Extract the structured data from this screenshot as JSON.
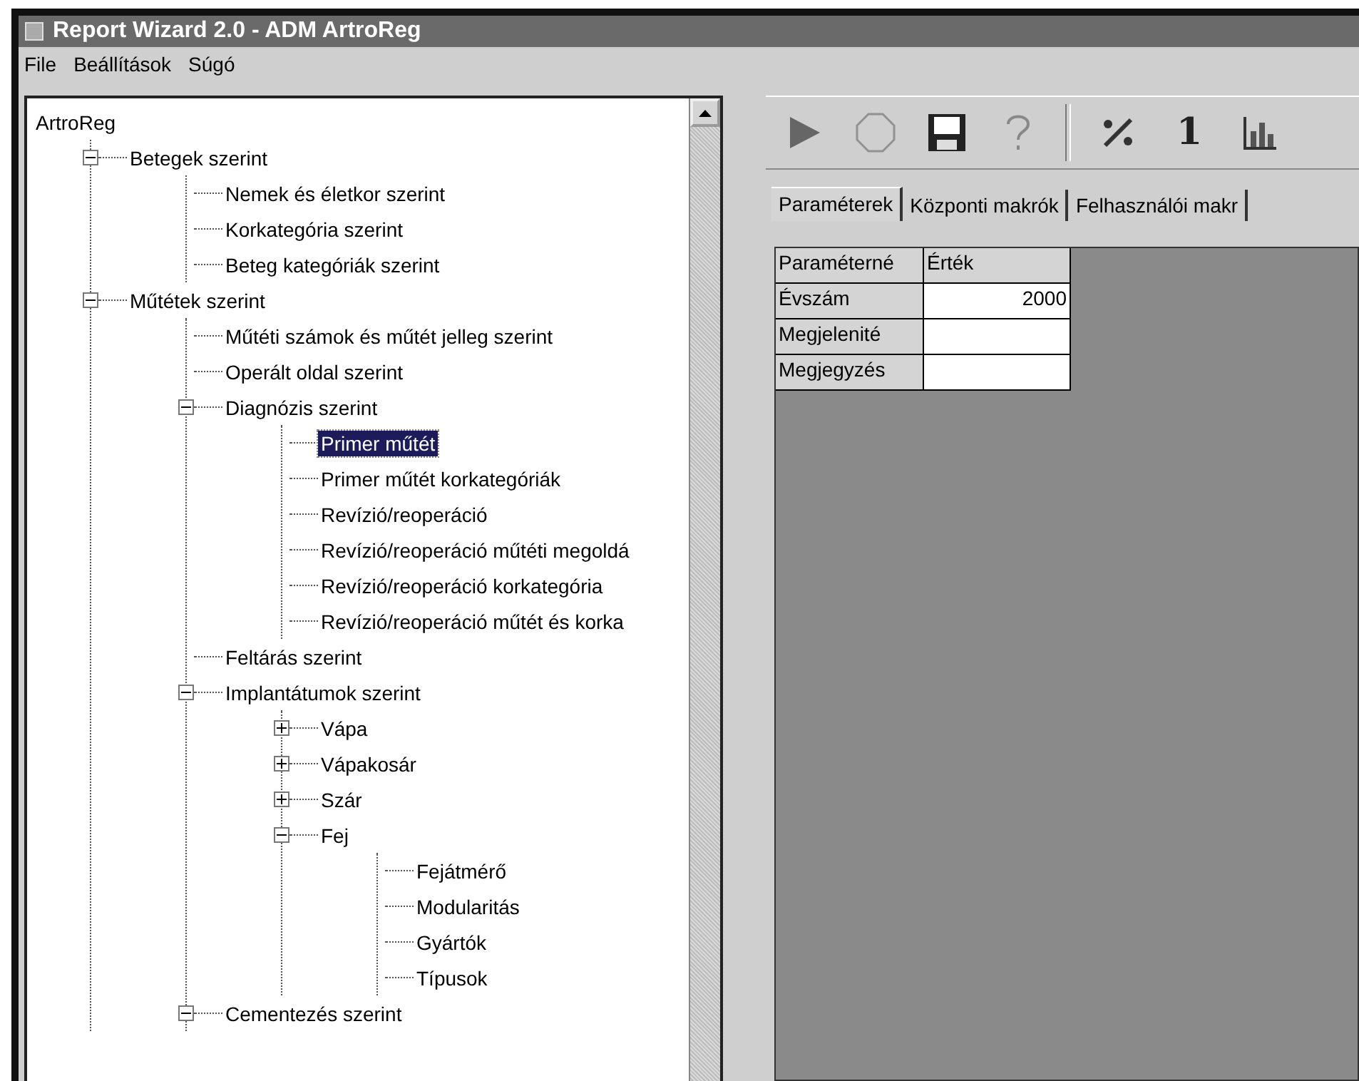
{
  "window": {
    "title": "Report Wizard 2.0 - ADM ArtroReg"
  },
  "menu": [
    "File",
    "Beállítások",
    "Súgó"
  ],
  "tree": {
    "label": "ArtroReg",
    "selected": false,
    "children": [
      {
        "label": "Betegek szerint",
        "expanded": true,
        "selected": false,
        "children": [
          {
            "label": "Nemek és életkor szerint",
            "selected": false
          },
          {
            "label": "Korkategória szerint",
            "selected": false
          },
          {
            "label": "Beteg kategóriák szerint",
            "selected": false
          }
        ]
      },
      {
        "label": "Műtétek szerint",
        "expanded": true,
        "selected": false,
        "children": [
          {
            "label": "Műtéti számok és műtét jelleg szerint",
            "selected": false
          },
          {
            "label": "Operált oldal szerint",
            "selected": false
          },
          {
            "label": "Diagnózis szerint",
            "expanded": true,
            "selected": false,
            "children": [
              {
                "label": "Primer műtét",
                "selected": true
              },
              {
                "label": "Primer műtét korkategóriák",
                "selected": false
              },
              {
                "label": "Revízió/reoperáció",
                "selected": false
              },
              {
                "label": "Revízió/reoperáció műtéti megoldá",
                "selected": false
              },
              {
                "label": "Revízió/reoperáció korkategória",
                "selected": false
              },
              {
                "label": "Revízió/reoperáció műtét és korka",
                "selected": false
              }
            ]
          },
          {
            "label": "Feltárás szerint",
            "selected": false
          },
          {
            "label": "Implantátumok szerint",
            "expanded": true,
            "selected": false,
            "children": [
              {
                "label": "Vápa",
                "expanded": false,
                "selected": false
              },
              {
                "label": "Vápakosár",
                "expanded": false,
                "selected": false
              },
              {
                "label": "Szár",
                "expanded": false,
                "selected": false
              },
              {
                "label": "Fej",
                "expanded": true,
                "selected": false,
                "children": [
                  {
                    "label": "Fejátmérő",
                    "selected": false
                  },
                  {
                    "label": "Modularitás",
                    "selected": false
                  },
                  {
                    "label": "Gyártók",
                    "selected": false
                  },
                  {
                    "label": "Típusok",
                    "selected": false
                  }
                ]
              }
            ]
          },
          {
            "label": "Cementezés szerint",
            "expanded": true,
            "selected": false
          }
        ]
      }
    ]
  },
  "toolbar": [
    {
      "kind": "play",
      "disabled": false
    },
    {
      "kind": "stop",
      "disabled": true
    },
    {
      "kind": "save",
      "disabled": false
    },
    {
      "kind": "help",
      "disabled": true
    },
    {
      "kind": "separator"
    },
    {
      "kind": "percent",
      "disabled": false
    },
    {
      "kind": "text",
      "label": "1",
      "disabled": false
    },
    {
      "kind": "chart",
      "disabled": false
    }
  ],
  "tabs": [
    {
      "label": "Paraméterek",
      "selected": true
    },
    {
      "label": "Központi makrók",
      "selected": false
    },
    {
      "label": "Felhasználói makr",
      "selected": false
    }
  ],
  "table": {
    "columns": [
      "Paraméterné",
      "Érték"
    ],
    "rows": [
      {
        "cells": [
          "Évszám",
          "2000"
        ]
      },
      {
        "cells": [
          "Megjelenité",
          ""
        ]
      },
      {
        "cells": [
          "Megjegyzés",
          ""
        ]
      }
    ]
  }
}
